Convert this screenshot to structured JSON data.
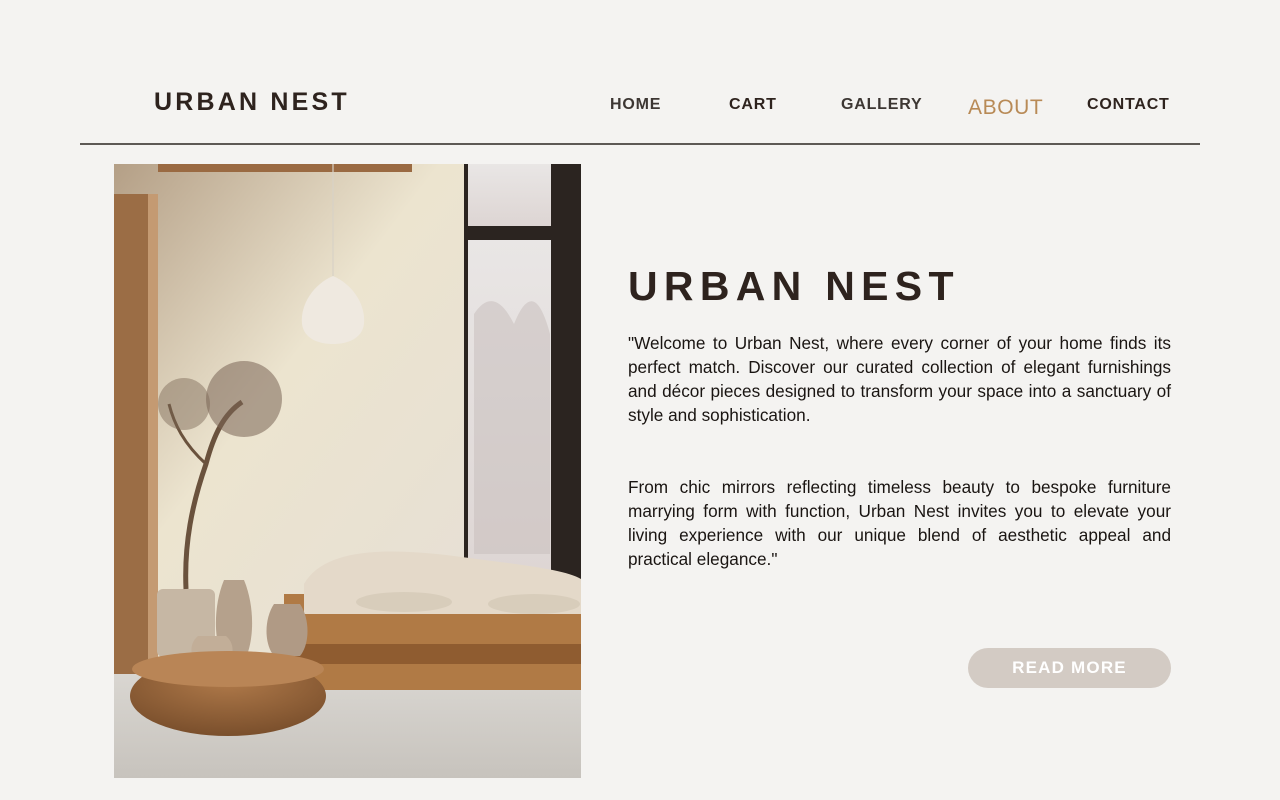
{
  "brand": {
    "logo": "URBAN NEST"
  },
  "nav": {
    "items": [
      {
        "label": "HOME"
      },
      {
        "label": "CART"
      },
      {
        "label": "GALLERY"
      },
      {
        "label": "ABOUT"
      },
      {
        "label": "CONTACT"
      }
    ],
    "active": "ABOUT"
  },
  "hero": {
    "title": "URBAN NEST",
    "paragraph1": "\"Welcome to Urban Nest, where every corner of your home finds its perfect match. Discover our curated collection of elegant furnishings and décor pieces designed to transform your space into a sanctuary of style and sophistication.",
    "paragraph2": " From chic mirrors reflecting timeless beauty to bespoke furniture marrying form with function, Urban Nest invites you to elevate your living experience with our unique blend of aesthetic appeal and practical elegance.\"",
    "button_label": "READ MORE"
  },
  "colors": {
    "background": "#f4f3f1",
    "text": "#2e231e",
    "accent": "#b88a56",
    "button": "#d3cbc4"
  }
}
